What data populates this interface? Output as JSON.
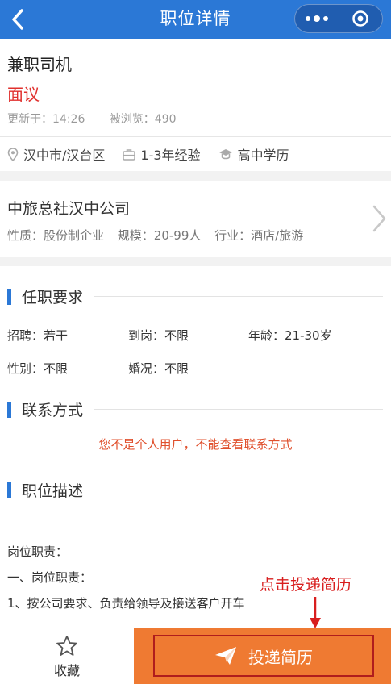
{
  "header": {
    "title": "职位详情",
    "back_icon": "chevron-left-icon",
    "more_icon": "more-dots-icon",
    "close_icon": "target-circle-icon"
  },
  "job": {
    "title": "兼职司机",
    "salary": "面议",
    "updated": "更新于：14:26",
    "views": "被浏览：490",
    "location": "汉中市/汉台区",
    "experience": "1-3年经验",
    "education": "高中学历"
  },
  "company": {
    "name": "中旅总社汉中公司",
    "nature": "性质：股份制企业",
    "scale": "规模：20-99人",
    "industry": "行业：酒店/旅游"
  },
  "requirements": {
    "heading": "任职要求",
    "recruit": "招聘：若干",
    "arrival": "到岗：不限",
    "age": "年龄：21-30岁",
    "gender": "性别：不限",
    "marital": "婚况：不限"
  },
  "contact": {
    "heading": "联系方式",
    "notice": "您不是个人用户，不能查看联系方式"
  },
  "description": {
    "heading": "职位描述",
    "lines": [
      "岗位职责：",
      "一、岗位职责：",
      "1、按公司要求、负责给领导及接送客户开车"
    ]
  },
  "bottom_bar": {
    "favorite_label": "收藏",
    "apply_label": "投递简历"
  },
  "annotation": {
    "text": "点击投递简历"
  },
  "colors": {
    "brand_blue": "#2b78d6",
    "salary_red": "#e0302d",
    "apply_orange": "#ef7a32",
    "notice_orange": "#e0502d",
    "annotation_red": "#d81e1e"
  }
}
